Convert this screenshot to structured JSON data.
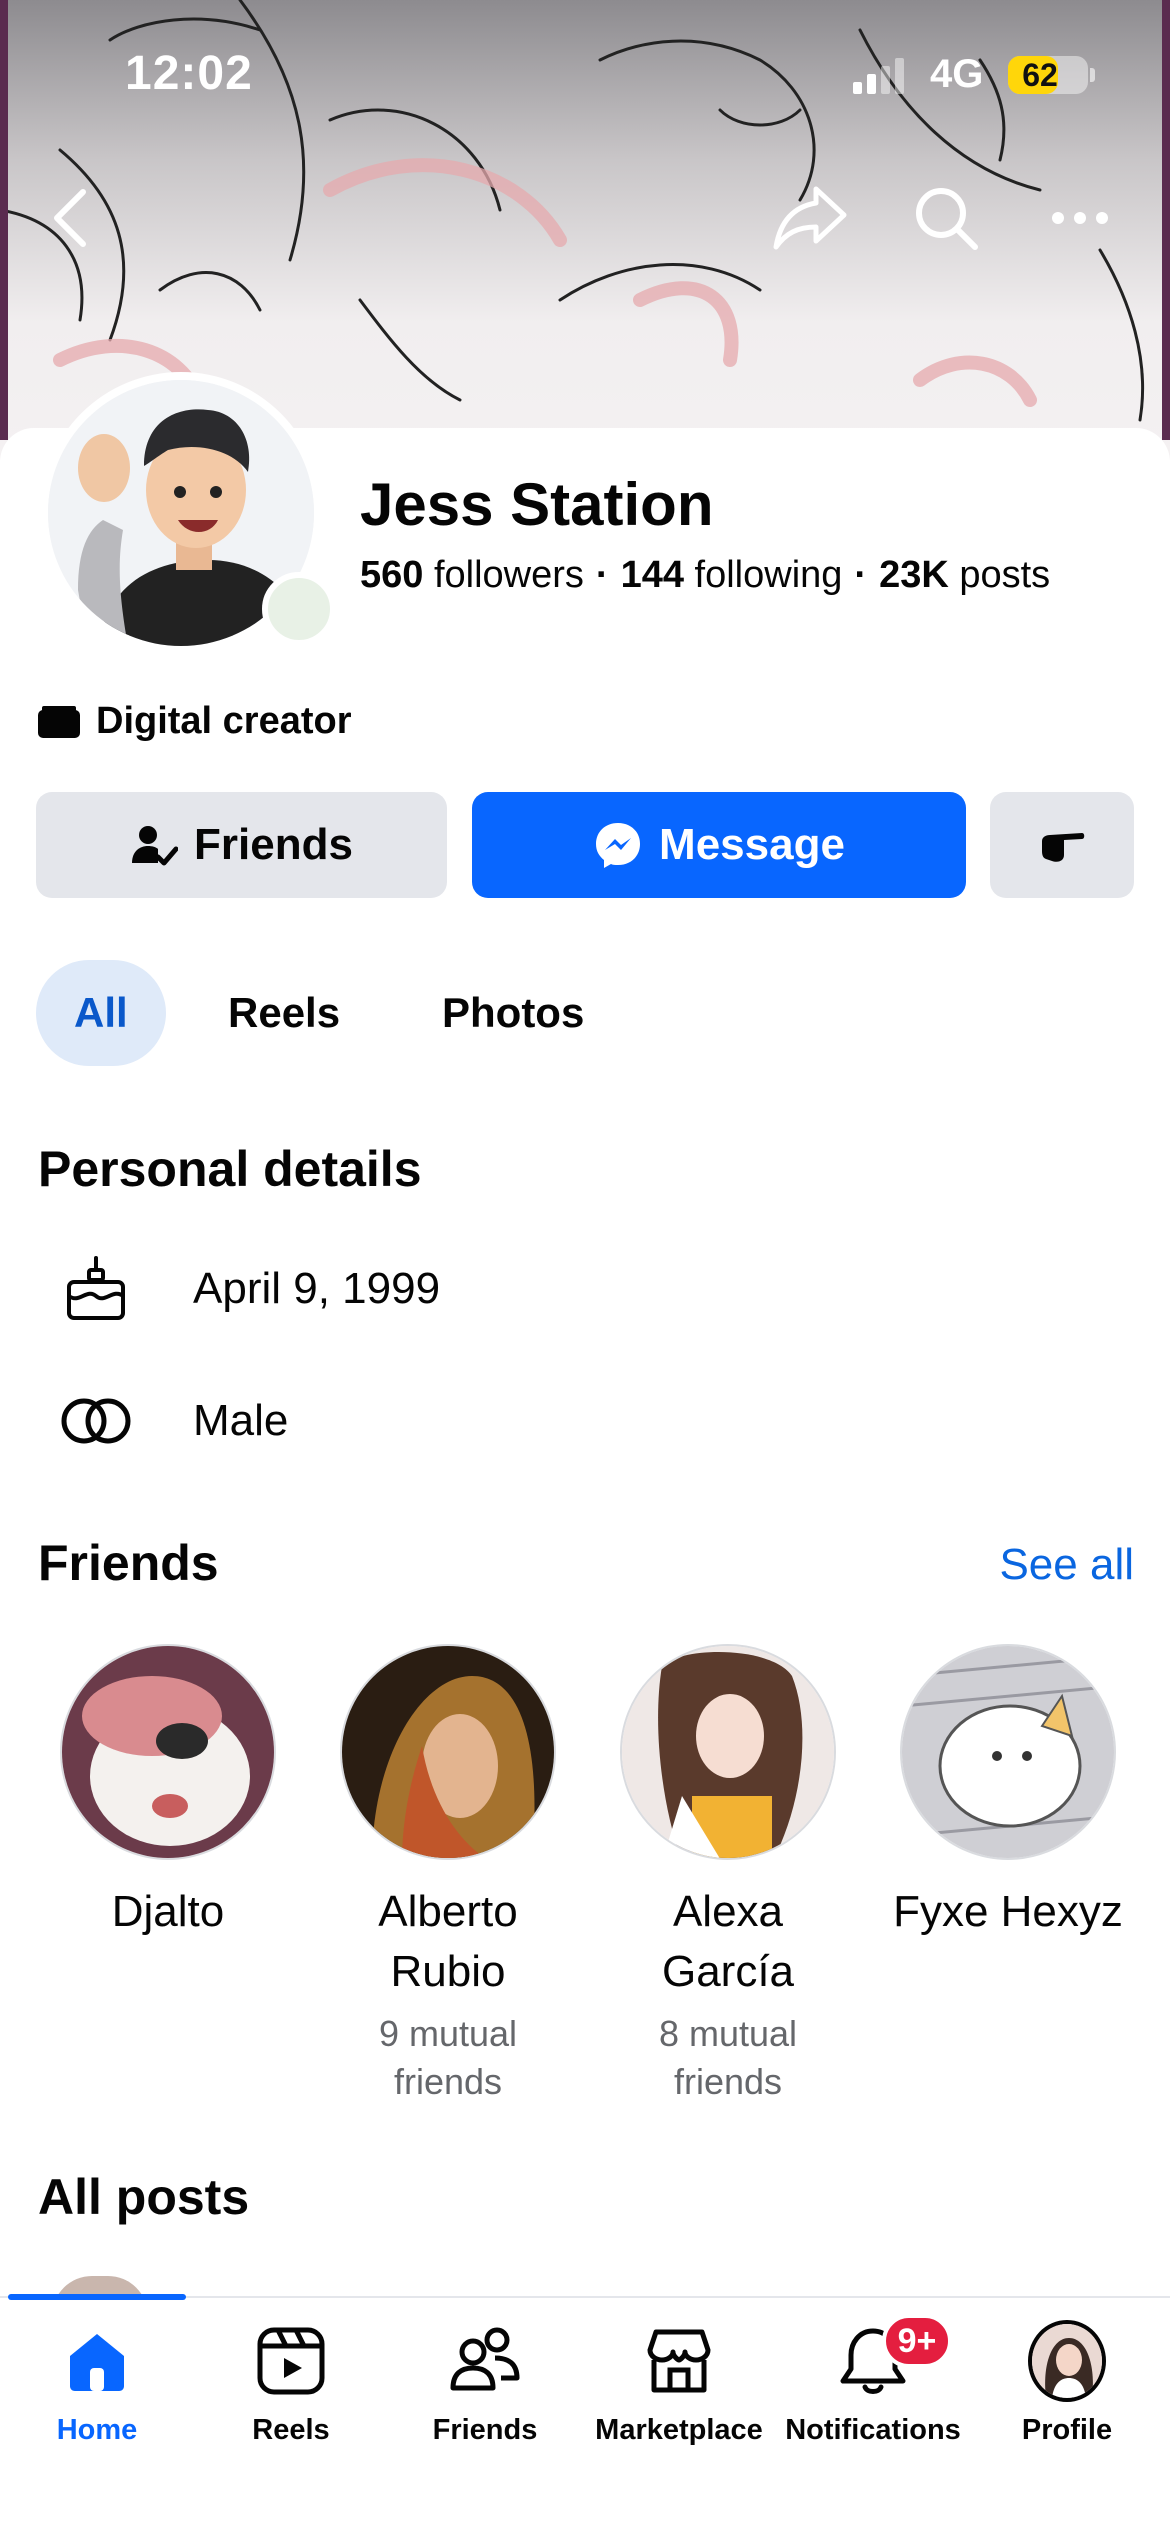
{
  "status_bar": {
    "time": "12:02",
    "network": "4G",
    "battery": "62",
    "battery_level": 0.62
  },
  "header": {
    "back_icon": "chevron-left-icon",
    "share_icon": "share-icon",
    "search_icon": "search-icon",
    "more_icon": "more-horizontal-icon"
  },
  "profile": {
    "name": "Jess Station",
    "followers_count": "560",
    "followers_label": "followers",
    "following_count": "144",
    "following_label": "following",
    "posts_count": "23K",
    "posts_label": "posts",
    "separator": "·",
    "category": "Digital creator"
  },
  "actions": {
    "friends_label": "Friends",
    "message_label": "Message"
  },
  "tabs": [
    {
      "label": "All",
      "active": true
    },
    {
      "label": "Reels",
      "active": false
    },
    {
      "label": "Photos",
      "active": false
    }
  ],
  "personal_details": {
    "title": "Personal details",
    "birthday": "April 9, 1999",
    "gender": "Male"
  },
  "friends": {
    "title": "Friends",
    "see_all": "See all",
    "items": [
      {
        "name": "Djalto",
        "mutual": ""
      },
      {
        "name": "Alberto Rubio",
        "mutual": "9 mutual friends"
      },
      {
        "name": "Alexa García",
        "mutual": "8 mutual friends"
      },
      {
        "name": "Fyxe Hexyz",
        "mutual": ""
      }
    ]
  },
  "all_posts": {
    "title": "All posts"
  },
  "nav": {
    "items": [
      {
        "label": "Home",
        "icon": "home-icon",
        "active": true
      },
      {
        "label": "Reels",
        "icon": "reels-icon",
        "active": false
      },
      {
        "label": "Friends",
        "icon": "friends-icon",
        "active": false
      },
      {
        "label": "Marketplace",
        "icon": "marketplace-icon",
        "active": false
      },
      {
        "label": "Notifications",
        "icon": "bell-icon",
        "active": false,
        "badge": "9+"
      },
      {
        "label": "Profile",
        "icon": "profile-avatar",
        "active": false
      }
    ]
  },
  "colors": {
    "accent": "#0866ff",
    "link": "#0a66e0",
    "badge": "#e41e3f",
    "button_gray": "#e4e6eb"
  }
}
